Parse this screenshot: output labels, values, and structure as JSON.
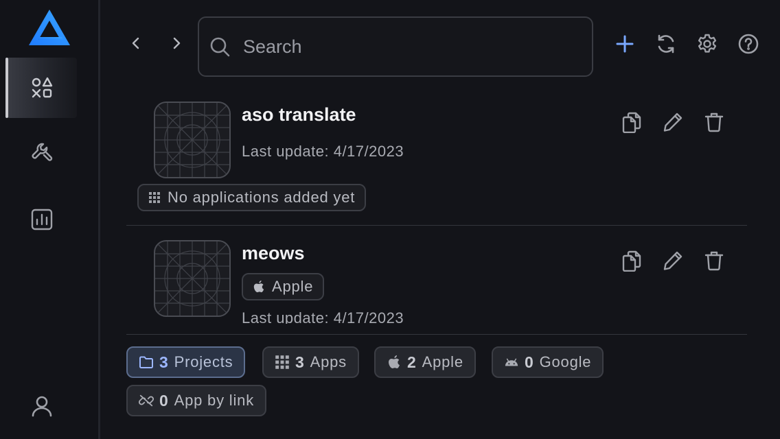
{
  "colors": {
    "accent": "#2f8cff",
    "accent_light": "#7aa8ff",
    "background": "#131419",
    "icon": "#9fa1a8"
  },
  "sidebar": {
    "logo": "app-logo",
    "items": [
      {
        "icon": "apps-shapes-icon",
        "active": true
      },
      {
        "icon": "tools-icon",
        "active": false
      },
      {
        "icon": "chart-icon",
        "active": false
      },
      {
        "icon": "user-icon",
        "active": false
      }
    ]
  },
  "search": {
    "placeholder": "Search",
    "value": ""
  },
  "projects": [
    {
      "title": "aso translate",
      "date": "Last update: 4/17/2023",
      "badge": "No applications added yet"
    },
    {
      "title": "meows",
      "platform": "Apple",
      "date": "Last update: 4/17/2023"
    }
  ],
  "stats": [
    {
      "count": "3",
      "label": "Projects",
      "active": true
    },
    {
      "count": "3",
      "label": "Apps",
      "active": false
    },
    {
      "count": "2",
      "label": "Apple",
      "active": false
    },
    {
      "count": "0",
      "label": "Google",
      "active": false
    },
    {
      "count": "0",
      "label": "App by link",
      "active": false
    }
  ]
}
